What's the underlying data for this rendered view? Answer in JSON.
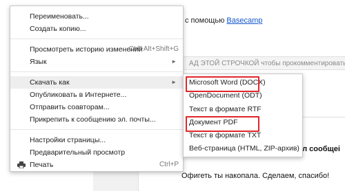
{
  "background": {
    "line1_prefix": "с помощью ",
    "line1_link": "Basecamp",
    "comment_hint": "АД ЭТОЙ СТРОЧКОЙ чтобы прокомментировать соо",
    "bold_text": "ал сообщеі",
    "message": "Офигеть ты накопала. Сделаем, спасибо!"
  },
  "menu": {
    "rename": "Переименовать...",
    "make_copy": "Создать копию...",
    "history": "Просмотреть историю изменений",
    "history_shortcut": "Ctrl+Alt+Shift+G",
    "language": "Язык",
    "download_as": "Скачать как",
    "publish": "Опубликовать в Интернете...",
    "email_collaborators": "Отправить соавторам...",
    "attach_email": "Прикрепить к сообщению эл. почты...",
    "page_setup": "Настройки страницы...",
    "print_preview": "Предварительный просмотр",
    "print": "Печать",
    "print_shortcut": "Ctrl+P"
  },
  "submenu": {
    "items": [
      {
        "label": "Microsoft Word (DOCX)",
        "marked": true
      },
      {
        "label": "OpenDocument (ODT)",
        "marked": false
      },
      {
        "label": "Текст в формате RTF",
        "marked": false
      },
      {
        "label": "Документ PDF",
        "marked": true
      },
      {
        "label": "Текст в формате TXT",
        "marked": false
      },
      {
        "label": "Веб-страница (HTML, ZIP-архив)",
        "marked": false
      }
    ]
  },
  "colors": {
    "highlight_border": "#e0252b",
    "link": "#1155cc"
  }
}
